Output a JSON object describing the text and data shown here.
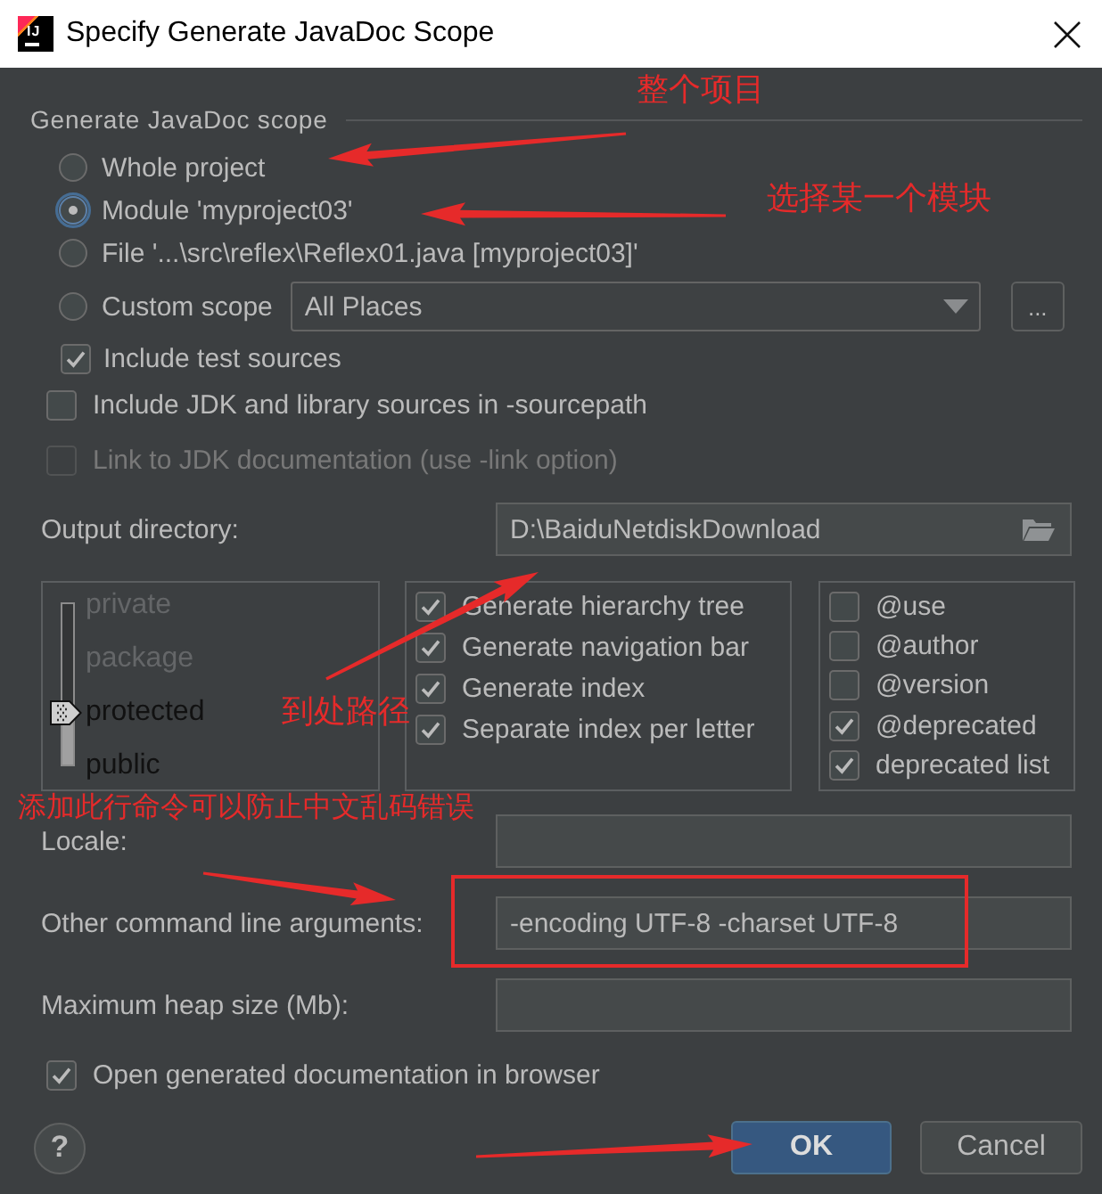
{
  "window": {
    "title": "Specify Generate JavaDoc Scope",
    "app_icon": "IJ"
  },
  "scope": {
    "title": "Generate JavaDoc scope",
    "options": [
      {
        "kind": "radio",
        "label": "Whole project",
        "selected": false
      },
      {
        "kind": "radio",
        "label": "Module 'myproject03'",
        "selected": true
      },
      {
        "kind": "radio",
        "label": "File '...\\src\\reflex\\Reflex01.java [myproject03]'",
        "selected": false
      },
      {
        "kind": "custom",
        "label": "Custom scope",
        "selected": false,
        "combo": "All Places",
        "browse": "..."
      }
    ],
    "include_tests": {
      "label": "Include test sources",
      "checked": true
    }
  },
  "options": [
    {
      "label": "Include JDK and library sources in -sourcepath",
      "checked": false,
      "disabled": false
    },
    {
      "label": "Link to JDK documentation (use -link option)",
      "checked": false,
      "disabled": true
    }
  ],
  "output_directory": {
    "label": "Output directory:",
    "value": "D:\\BaiduNetdiskDownload"
  },
  "visibility": [
    {
      "label": "private",
      "included": false
    },
    {
      "label": "package",
      "included": false
    },
    {
      "label": "protected",
      "included": true
    },
    {
      "label": "public",
      "included": true
    }
  ],
  "generate": [
    {
      "label": "Generate hierarchy tree",
      "checked": true
    },
    {
      "label": "Generate navigation bar",
      "checked": true
    },
    {
      "label": "Generate index",
      "checked": true
    },
    {
      "label": "Separate index per letter",
      "checked": true
    }
  ],
  "tags": [
    {
      "label": "@use",
      "checked": false
    },
    {
      "label": "@author",
      "checked": false
    },
    {
      "label": "@version",
      "checked": false
    },
    {
      "label": "@deprecated",
      "checked": true
    },
    {
      "label": "deprecated list",
      "checked": true
    }
  ],
  "fields": [
    {
      "label": "Locale:"
    },
    {
      "label": "Other command line arguments:",
      "value": "-encoding UTF-8 -charset UTF-8"
    },
    {
      "label": "Maximum heap size (Mb):"
    }
  ],
  "open_in_browser": {
    "label": "Open generated documentation in browser",
    "checked": true
  },
  "help": "?",
  "buttons": [
    {
      "label": "OK",
      "kind": "default"
    },
    {
      "label": "Cancel",
      "kind": "normal"
    }
  ],
  "annotations": [
    {
      "text": "整个项目"
    },
    {
      "text": "选择某一个模块"
    },
    {
      "text": "到处路径"
    },
    {
      "text": "添加此行命令可以防止中文乱码错误"
    }
  ]
}
